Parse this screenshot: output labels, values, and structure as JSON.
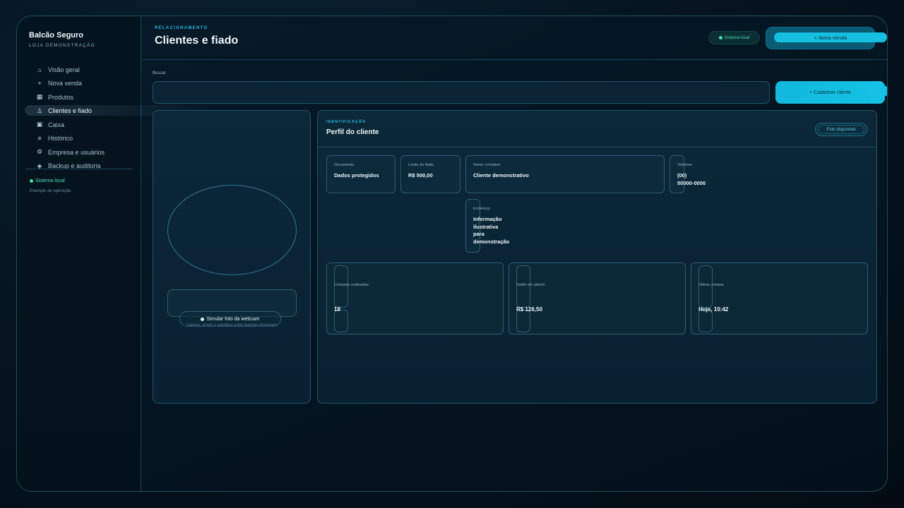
{
  "brand": {
    "name": "Balcão Seguro",
    "subtitle": "LOJA DEMONSTRAÇÃO"
  },
  "sidebar": {
    "items": [
      {
        "label": "Visão geral",
        "icon": "home-icon",
        "glyph": "⌂"
      },
      {
        "label": "Nova venda",
        "icon": "plus-icon",
        "glyph": "+"
      },
      {
        "label": "Produtos",
        "icon": "grid-icon",
        "glyph": "▦"
      },
      {
        "label": "Clientes e fiado",
        "icon": "person-icon",
        "glyph": "♙",
        "active": true
      },
      {
        "label": "Caixa",
        "icon": "cash-register-icon",
        "glyph": "▣"
      },
      {
        "label": "Histórico",
        "icon": "list-icon",
        "glyph": "≡"
      },
      {
        "label": "Empresa e usuários",
        "icon": "gear-icon",
        "glyph": "⚙"
      },
      {
        "label": "Backup e auditoria",
        "icon": "shield-icon",
        "glyph": "◈"
      }
    ],
    "status": "Sistema local",
    "note": "Exemplo de operação."
  },
  "header": {
    "eyebrow": "RELACIONAMENTO",
    "title": "Clientes e fiado",
    "status": "Sistema local",
    "new_sale_label": "+ Nova venda"
  },
  "search": {
    "label": "Buscar",
    "value": "",
    "placeholder": "",
    "register_label": "+ Cadastrar cliente"
  },
  "photo_panel": {
    "webcam_label": "Simular foto da webcam",
    "hint": "Capture, revise e substitua a foto quando necessário."
  },
  "profile": {
    "eyebrow": "IDENTIFICAÇÃO",
    "title": "Perfil do cliente",
    "photo_badge": "Foto disponível",
    "fields": {
      "document": {
        "label": "Documento",
        "value": "Dados protegidos"
      },
      "credit_limit": {
        "label": "Limite do fiado",
        "value": "R$ 500,00"
      },
      "full_name": {
        "label": "Nome completo",
        "value": "Cliente demonstrativo"
      },
      "phone": {
        "label": "Telefone",
        "value": "(00)\n00000-0000"
      },
      "address": {
        "label": "Endereço",
        "value": "Informação\nilustrativa\npara\ndemonstração"
      }
    },
    "stats": [
      {
        "label": "Compras realizadas",
        "value": "18"
      },
      {
        "label": "Saldo em aberto",
        "value": "R$ 126,50"
      },
      {
        "label": "Última compra",
        "value": "Hoje, 10:42"
      }
    ]
  },
  "colors": {
    "accent": "#16bee0",
    "status_green": "#3fe0a8",
    "panel": "#0b2738",
    "border": "#24536a"
  }
}
